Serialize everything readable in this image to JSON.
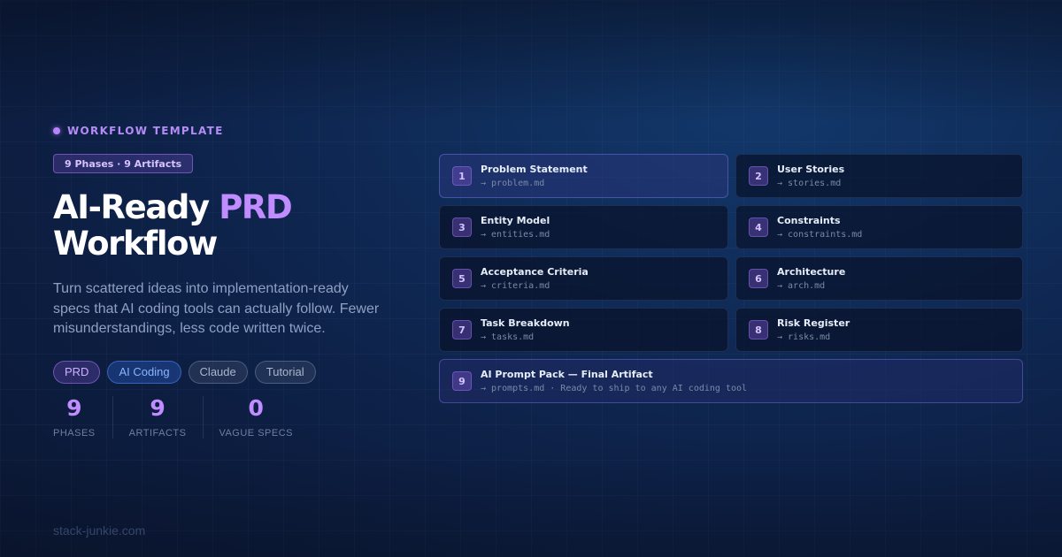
{
  "eyebrow": "WORKFLOW TEMPLATE",
  "pill": "9 Phases · 9 Artifacts",
  "title": {
    "part1": "AI-Ready",
    "accent": "PRD",
    "part2": "Workflow"
  },
  "description": "Turn scattered ideas into implementation-ready specs that AI coding tools can actually follow. Fewer misunderstandings, less code written twice.",
  "tags": [
    "PRD",
    "AI Coding",
    "Claude",
    "Tutorial"
  ],
  "stats": [
    {
      "value": "9",
      "label": "PHASES"
    },
    {
      "value": "9",
      "label": "ARTIFACTS"
    },
    {
      "value": "0",
      "label": "VAGUE SPECS"
    }
  ],
  "phases": [
    {
      "num": "1",
      "title": "Problem Statement",
      "file": "→ problem.md"
    },
    {
      "num": "2",
      "title": "User Stories",
      "file": "→ stories.md"
    },
    {
      "num": "3",
      "title": "Entity Model",
      "file": "→ entities.md"
    },
    {
      "num": "4",
      "title": "Constraints",
      "file": "→ constraints.md"
    },
    {
      "num": "5",
      "title": "Acceptance Criteria",
      "file": "→ criteria.md"
    },
    {
      "num": "6",
      "title": "Architecture",
      "file": "→ arch.md"
    },
    {
      "num": "7",
      "title": "Task Breakdown",
      "file": "→ tasks.md"
    },
    {
      "num": "8",
      "title": "Risk Register",
      "file": "→ risks.md"
    },
    {
      "num": "9",
      "title": "AI Prompt Pack — Final Artifact",
      "file": "→ prompts.md · Ready to ship to any AI coding tool"
    }
  ],
  "footer": "stack-junkie.com",
  "colors": {
    "accent": "#c08cff",
    "background": "#0f2a56",
    "muted_text": "#8fa0c4"
  }
}
